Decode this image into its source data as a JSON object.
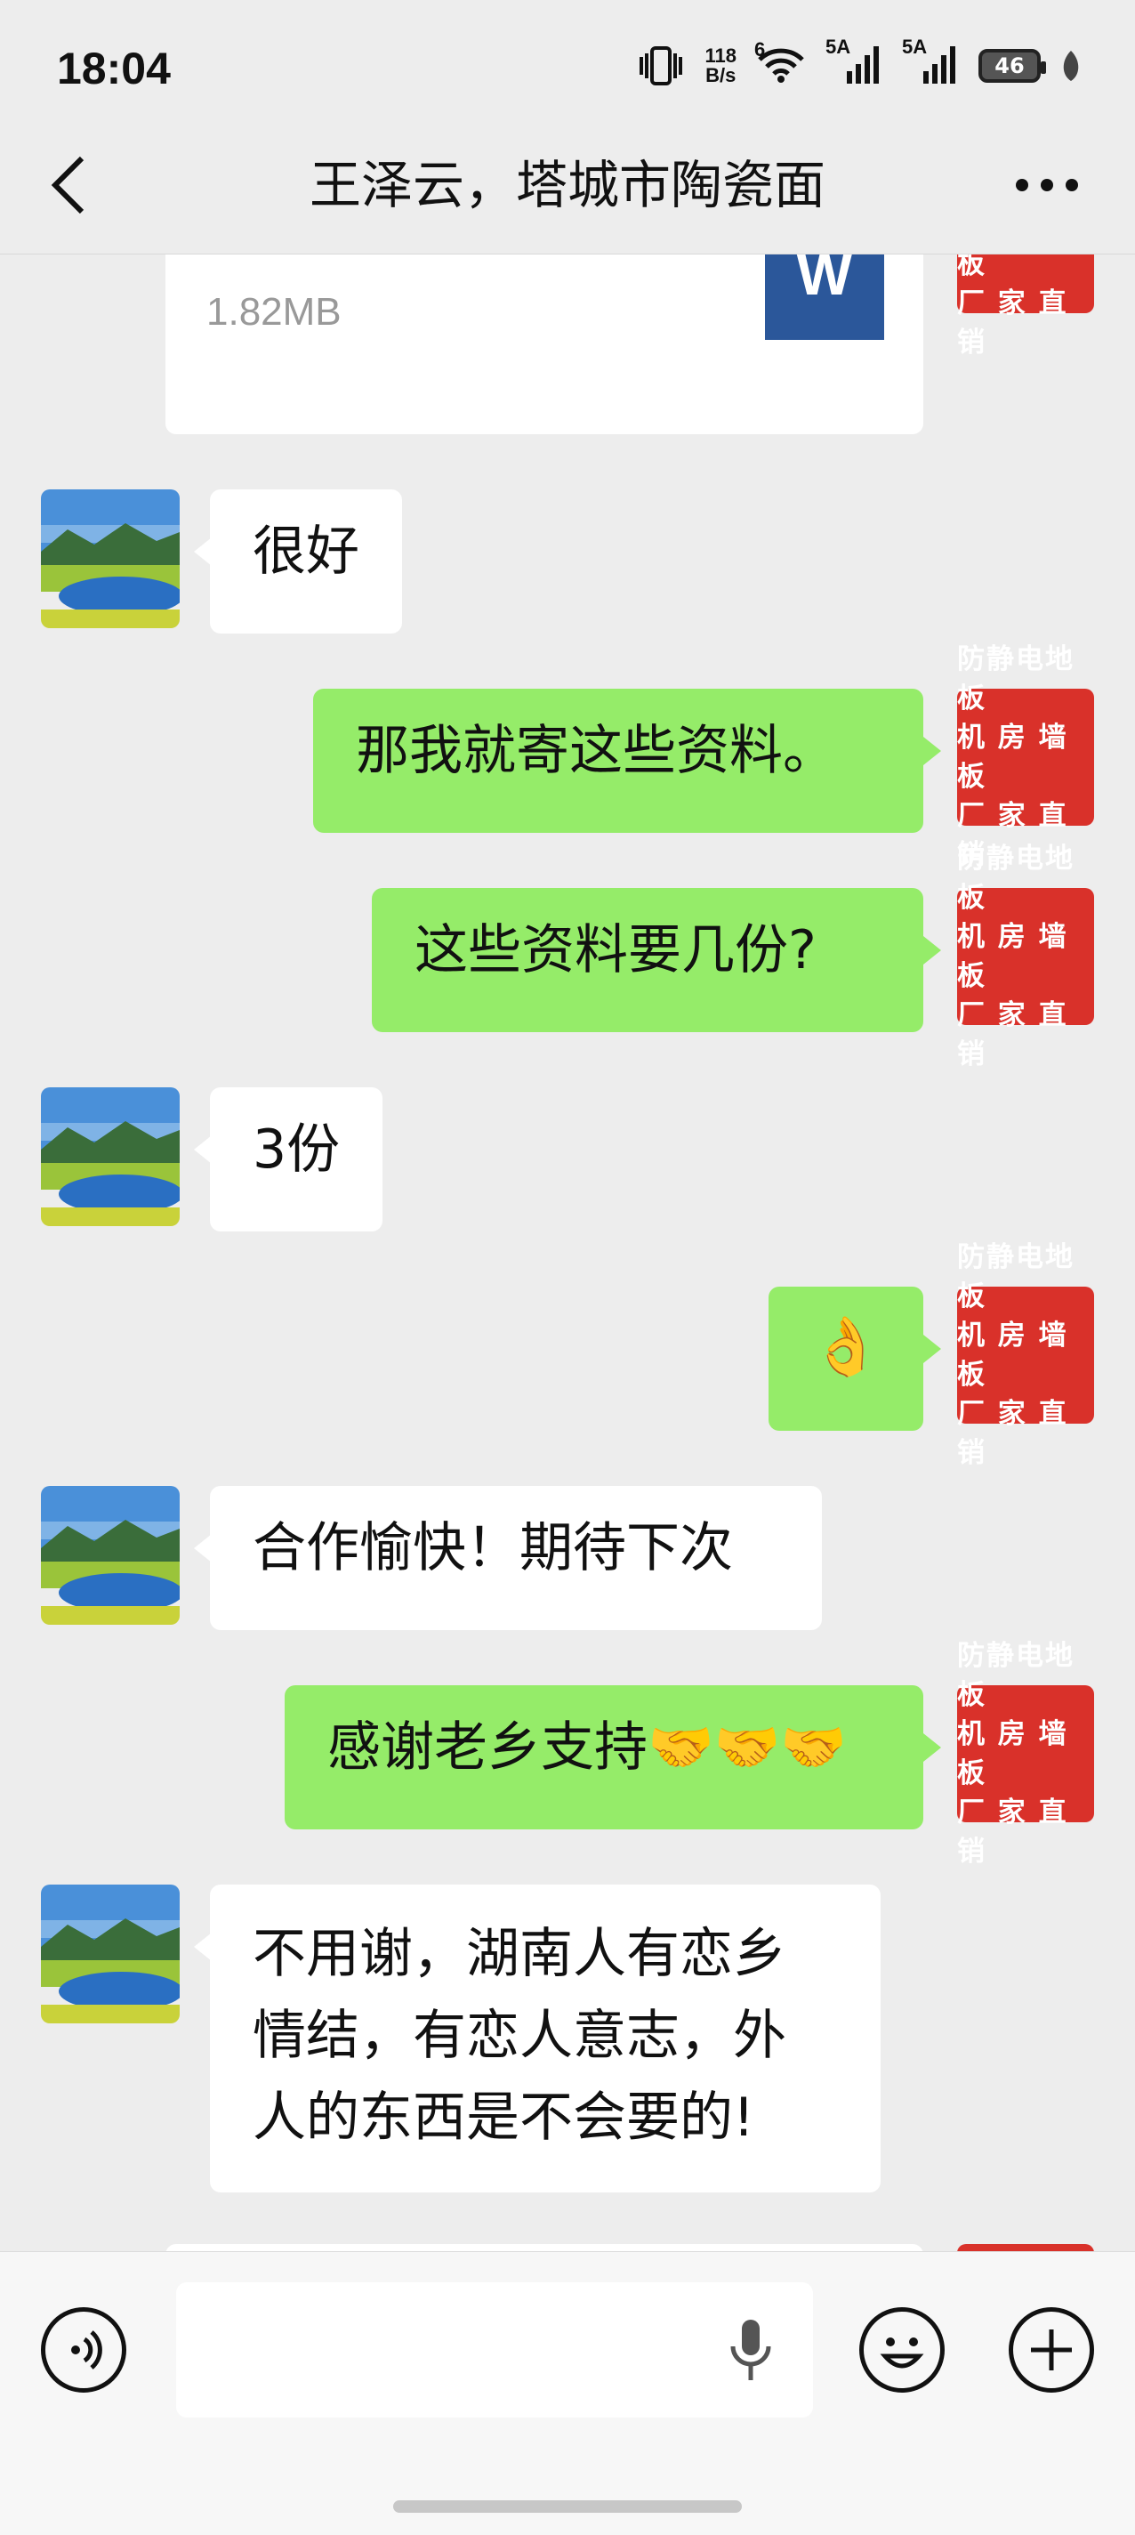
{
  "status_bar": {
    "time": "18:04",
    "net_speed_value": "118",
    "net_speed_unit": "B/s",
    "signal_1": "5A",
    "signal_2": "5A",
    "wifi_label": "6",
    "battery": "46"
  },
  "header": {
    "title": "王泽云，塔城市陶瓷面"
  },
  "file_message": {
    "size": "1.82MB",
    "icon_letter": "W"
  },
  "my_avatar": {
    "line1": "防静电地板",
    "line2": "机 房 墙 板",
    "line3": "厂 家 直 销"
  },
  "messages": [
    {
      "side": "in",
      "text": "很好"
    },
    {
      "side": "out",
      "text": "那我就寄这些资料。"
    },
    {
      "side": "out",
      "text": "这些资料要几份?"
    },
    {
      "side": "in",
      "text": "3份"
    },
    {
      "side": "out",
      "text": "👌"
    },
    {
      "side": "in",
      "text": "合作愉快！期待下次"
    },
    {
      "side": "out",
      "text": "感谢老乡支持🤝🤝🤝"
    },
    {
      "side": "in",
      "line1": "不用谢，湖南人有恋乡",
      "line2": "情结，有恋人意志，外",
      "line3": "人的东西是不会要的!"
    }
  ],
  "colors": {
    "outgoing_bubble": "#95ec69",
    "incoming_bubble": "#ffffff",
    "avatar_red": "#d9312a",
    "background": "#ededed"
  }
}
